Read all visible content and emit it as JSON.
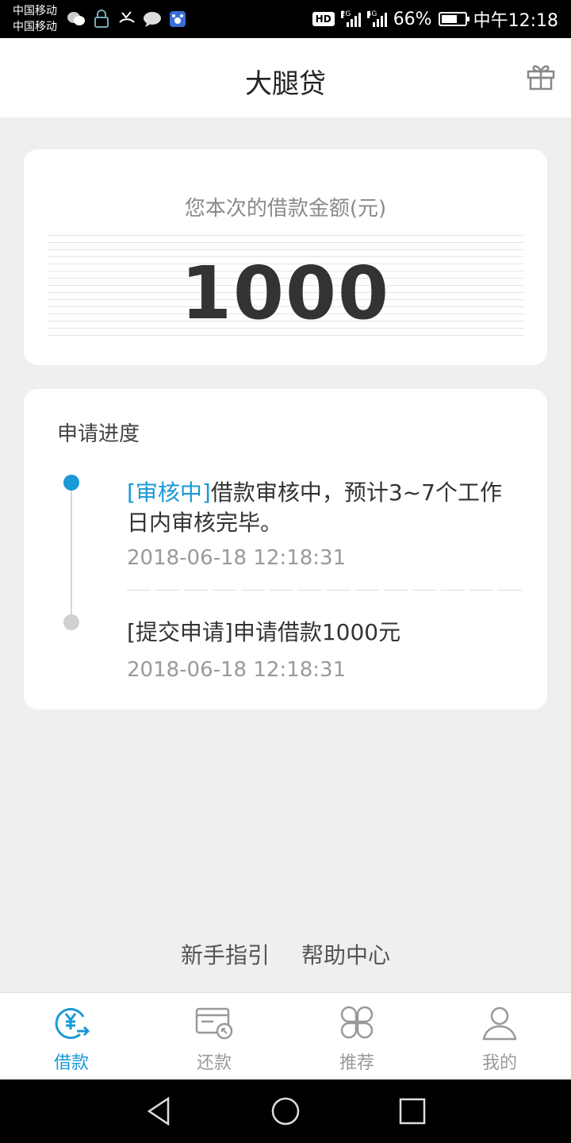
{
  "status_bar": {
    "carrier_1": "中国移动",
    "carrier_2": "中国移动",
    "hd": "HD",
    "net1": "2G",
    "net2": "4G",
    "battery": "66%",
    "time": "中午12:18"
  },
  "header": {
    "title": "大腿贷",
    "right_icon": "gift-icon"
  },
  "amount_card": {
    "label": "您本次的借款金额(元)",
    "value": "1000"
  },
  "progress": {
    "title": "申请进度",
    "steps": [
      {
        "tag": "[审核中]",
        "text": "借款审核中，预计3~7个工作日内审核完毕。",
        "time": "2018-06-18 12:18:31",
        "status": "active"
      },
      {
        "text": "[提交申请]申请借款1000元",
        "time": "2018-06-18 12:18:31",
        "status": "done"
      }
    ]
  },
  "links": {
    "guide": "新手指引",
    "help": "帮助中心"
  },
  "bottom_nav": [
    {
      "label": "借款",
      "icon": "loan-yen-icon",
      "active": true
    },
    {
      "label": "还款",
      "icon": "repay-card-icon",
      "active": false
    },
    {
      "label": "推荐",
      "icon": "recommend-grid-icon",
      "active": false
    },
    {
      "label": "我的",
      "icon": "user-icon",
      "active": false
    }
  ],
  "colors": {
    "accent": "#1a9ad6",
    "background": "#efefef",
    "card": "#ffffff",
    "inactive": "#999999"
  }
}
